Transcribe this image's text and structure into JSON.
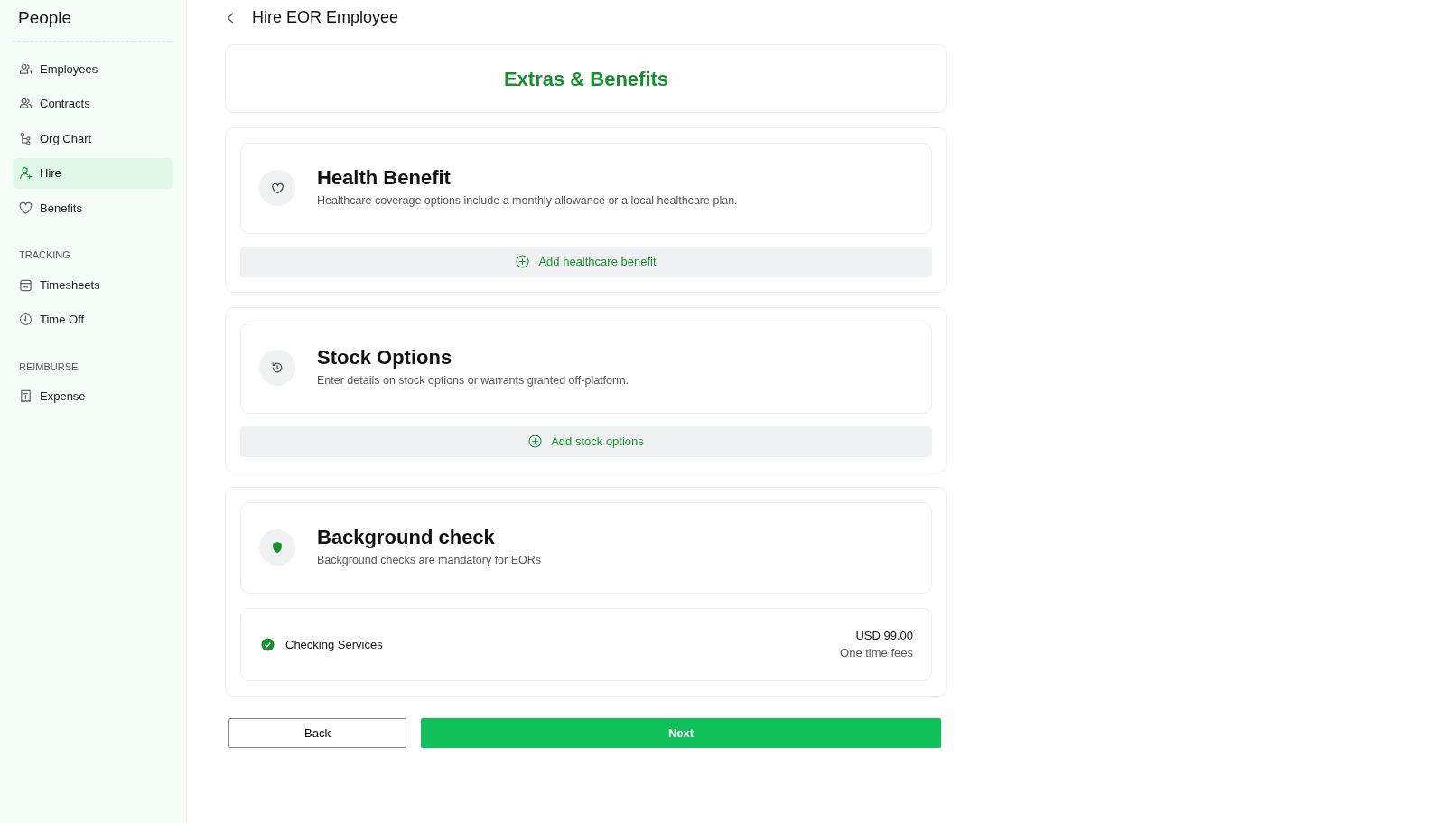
{
  "sidebar": {
    "title": "People",
    "groups": [
      {
        "items": [
          {
            "label": "Employees",
            "selected": false
          },
          {
            "label": "Contracts",
            "selected": false
          },
          {
            "label": "Org Chart",
            "selected": false
          },
          {
            "label": "Hire",
            "selected": true
          },
          {
            "label": "Benefits",
            "selected": false
          }
        ]
      },
      {
        "heading": "TRACKING",
        "items": [
          {
            "label": "Timesheets",
            "selected": false
          },
          {
            "label": "Time Off",
            "selected": false
          }
        ]
      },
      {
        "heading": "REIMBURSE",
        "items": [
          {
            "label": "Expense",
            "selected": false
          }
        ]
      }
    ]
  },
  "page": {
    "title": "Hire EOR Employee"
  },
  "header": {
    "title": "Extras & Benefits"
  },
  "sections": [
    {
      "kind": "action",
      "title": "Health Benefit",
      "description": "Healthcare coverage options include a monthly allowance or a local healthcare plan.",
      "action": "Add healthcare benefit"
    },
    {
      "kind": "action",
      "title": "Stock Options",
      "description": "Enter details on stock options or warrants granted off-platform.",
      "action": "Add stock options"
    },
    {
      "kind": "service",
      "title": "Background check",
      "description": "Background checks are mandatory for EORs",
      "service": {
        "label": "Checking Services",
        "checked": true,
        "price": "USD 99.00",
        "note": "One time fees"
      }
    }
  ],
  "buttons": {
    "back": "Back",
    "next": "Next"
  }
}
